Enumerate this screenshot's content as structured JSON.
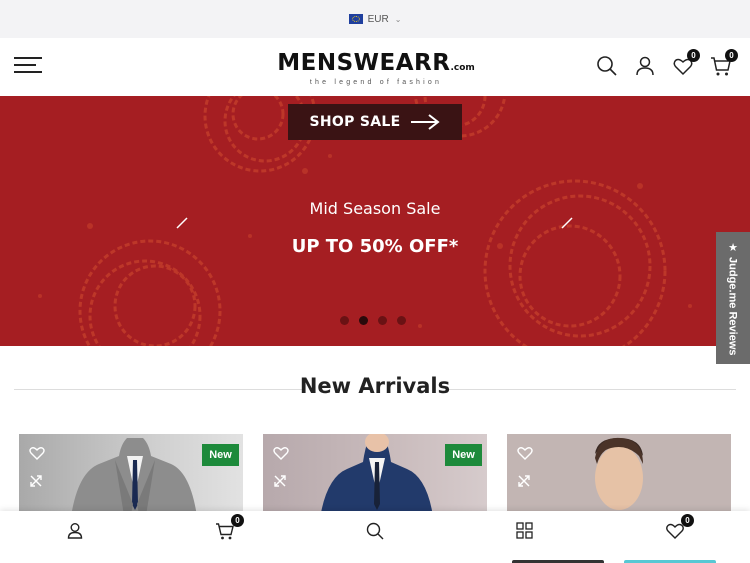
{
  "topbar": {
    "currency": "EUR"
  },
  "header": {
    "logo_main": "MENSWEARR",
    "logo_suffix": ".com",
    "logo_tagline": "the legend of fashion",
    "wishlist_count": "0",
    "cart_count": "0"
  },
  "hero": {
    "button_label": "SHOP SALE",
    "subtitle": "Mid Season Sale",
    "title": "UP TO 50% OFF*",
    "slide_count": 4,
    "active_slide": 2,
    "colors": {
      "background": "#a51e22",
      "button": "#3a1314"
    }
  },
  "reviews_tab": {
    "label": "★ Judge.me Reviews"
  },
  "section": {
    "title": "New Arrivals"
  },
  "products": [
    {
      "badge": "New"
    },
    {
      "badge": "New"
    },
    {
      "badge": ""
    }
  ],
  "bottom_nav": {
    "cart_count": "0",
    "wishlist_count": "0",
    "items": [
      "user-icon",
      "cart-icon",
      "search-icon",
      "grid-icon",
      "heart-icon"
    ]
  },
  "colors": {
    "new_badge": "#1d8a3b",
    "accent_cyan": "#58c8d4"
  }
}
